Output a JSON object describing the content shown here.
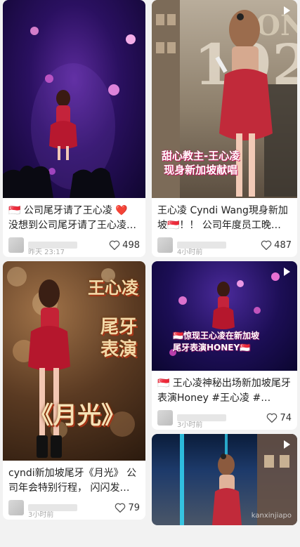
{
  "feed": {
    "left": [
      {
        "title": "🇸🇬 公司尾牙请了王心凌 ❤️ 没想到公司尾牙请了王心凌…",
        "time": "昨天 23:17",
        "likes": "498",
        "overlay": "",
        "has_play": false
      },
      {
        "title": "cyndi新加坡尾牙《月光》 公司年会特别行程， 闪闪发…",
        "time": "3小时前",
        "likes": "79",
        "overlay": "王心凌|尾牙|表演|《月光》",
        "has_play": false
      }
    ],
    "right": [
      {
        "title": "王心凌 Cyndi Wang現身新加坡🇸🇬！！ 公司年度员工晚…",
        "time": "4小时前",
        "likes": "487",
        "overlay": "甜心教主-王心凌|现身新加坡献唱",
        "has_play": true
      },
      {
        "title": "🇸🇬 王心凌神秘出场新加坡尾牙表演Honey #王心凌 #…",
        "time": "3小时前",
        "likes": "74",
        "overlay": "🇸🇬惊现王心凌在新加坡|尾牙表演HONEY🇸🇬",
        "has_play": true
      },
      {
        "title": "",
        "time": "",
        "likes": "",
        "overlay": "",
        "has_play": true
      }
    ]
  },
  "watermark": "kanxinjiapo",
  "colors": {
    "heart": "#555555",
    "meta_text": "#aaaaaa",
    "title_text": "#222222"
  }
}
